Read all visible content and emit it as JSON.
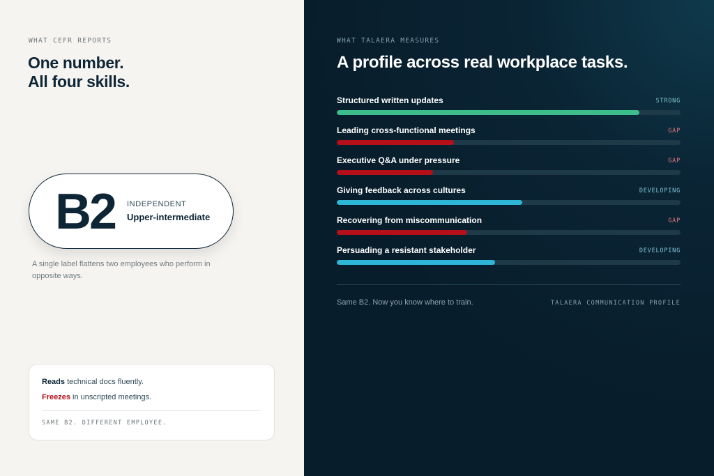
{
  "left": {
    "eyebrow": "WHAT CEFR REPORTS",
    "title_line1": "One number.",
    "title_line2": "All four skills.",
    "badge": {
      "grade": "B2",
      "band": "INDEPENDENT",
      "level": "Upper-intermediate"
    },
    "caption": "A single label flattens two employees who perform in opposite ways.",
    "card": {
      "line1_highlight": "Reads",
      "line1_rest": " technical docs fluently.",
      "line2_highlight": "Freezes",
      "line2_rest": " in unscripted meetings.",
      "footer": "SAME B2. DIFFERENT EMPLOYEE."
    }
  },
  "right": {
    "eyebrow": "WHAT TALAERA MEASURES",
    "title": "A profile across real workplace tasks.",
    "skills": [
      {
        "name": "Structured written updates",
        "status": "STRONG",
        "level": 0.88
      },
      {
        "name": "Leading cross-functional meetings",
        "status": "GAP",
        "level": 0.34
      },
      {
        "name": "Executive Q&A under pressure",
        "status": "GAP",
        "level": 0.28
      },
      {
        "name": "Giving feedback across cultures",
        "status": "DEVELOPING",
        "level": 0.54
      },
      {
        "name": "Recovering from miscommunication",
        "status": "GAP",
        "level": 0.38
      },
      {
        "name": "Persuading a resistant stakeholder",
        "status": "DEVELOPING",
        "level": 0.46
      }
    ],
    "footer_left": "Same B2. Now you know where to train.",
    "footer_right": "TALAERA COMMUNICATION PROFILE"
  },
  "status_colors": {
    "STRONG": {
      "bar": "#3dbd8c",
      "text": "#7fc2c6"
    },
    "GAP": {
      "bar": "#b5101a",
      "text": "#e07880"
    },
    "DEVELOPING": {
      "bar": "#2db6d6",
      "text": "#7fc2d6"
    }
  }
}
